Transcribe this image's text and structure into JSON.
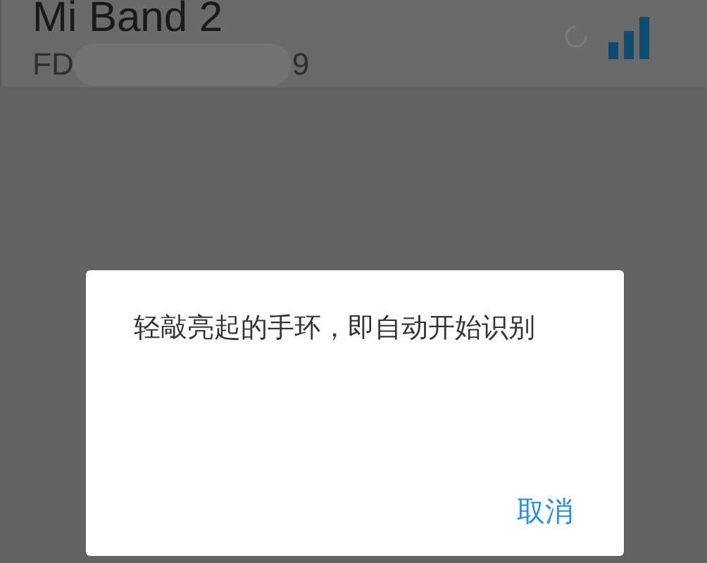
{
  "device": {
    "name": "Mi Band 2",
    "id_start": "FD",
    "id_end": "9"
  },
  "dialog": {
    "message": "轻敲亮起的手环，即自动开始识别",
    "buttons": [
      "取消"
    ]
  }
}
